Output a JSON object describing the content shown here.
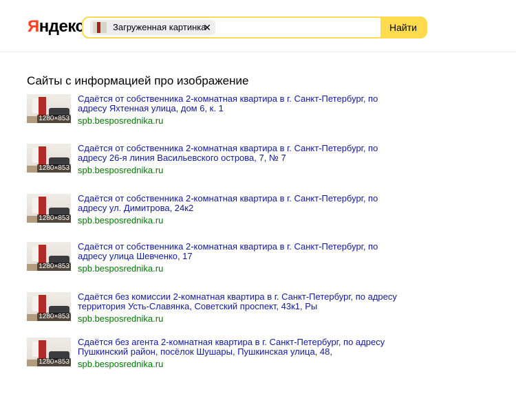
{
  "header": {
    "logo_first": "Я",
    "logo_rest": "ндекс",
    "search_chip_label": "Загруженная картинка",
    "search_chip_close": "✕",
    "search_button": "Найти"
  },
  "colors": {
    "brand_red": "#fc3f1d",
    "search_yellow": "#ffdb4d",
    "link_blue": "#10199c",
    "url_green": "#007700"
  },
  "section_title": "Сайты с информацией про изображение",
  "results": [
    {
      "title": "Сдаётся от собственника 2-комнатная квартира в г. Санкт-Петербург, по адресу Яхтенная улица, дом 6, к. 1",
      "url": "spb.besposrednika.ru",
      "size": "1280×853"
    },
    {
      "title": "Сдаётся от собственника 2-комнатная квартира в г. Санкт-Петербург, по адресу 26-я линия Васильевского острова, 7, № 7",
      "url": "spb.besposrednika.ru",
      "size": "1280×853"
    },
    {
      "title": "Сдаётся от собственника 2-комнатная квартира в г. Санкт-Петербург, по адресу ул. Димитрова, 24к2",
      "url": "spb.besposrednika.ru",
      "size": "1280×853"
    },
    {
      "title": "Сдаётся от собственника 2-комнатная квартира в г. Санкт-Петербург, по адресу улица Шевченко, 17",
      "url": "spb.besposrednika.ru",
      "size": "1280×853"
    },
    {
      "title": "Сдаётся без комиссии 2-комнатная квартира в г. Санкт-Петербург, по адресу территория Усть-Славянка, Советский проспект, 43к1, Ры",
      "url": "spb.besposrednika.ru",
      "size": "1280×853"
    },
    {
      "title": "Сдаётся без агента 2-комнатная квартира в г. Санкт-Петербург, по адресу Пушкинский район, посёлок Шушары, Пушкинская улица, 48,",
      "url": "spb.besposrednika.ru",
      "size": "1280×853"
    }
  ]
}
